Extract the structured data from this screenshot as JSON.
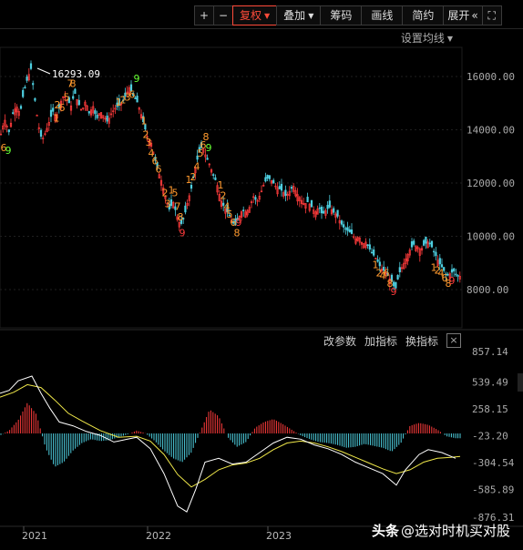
{
  "toolbar": {
    "plus_label": "+",
    "minus_label": "−",
    "fuquan_label": "复权",
    "diejia_label": "叠加",
    "chouma_label": "筹码",
    "huaxian_label": "画线",
    "jianyue_label": "简约",
    "zhankai_label": "展开",
    "collapse_icon": "«",
    "fullscreen_icon": "⛶",
    "active_color": "#ff4b3a"
  },
  "main_panel": {
    "ma_setting_label": "设置均线",
    "peak_label": "16293.09",
    "y_ticks": [
      "16000.00",
      "14000.00",
      "12000.00",
      "10000.00",
      "8000.00"
    ]
  },
  "indicator_panel": {
    "change_params_label": "改参数",
    "add_indicator_label": "加指标",
    "switch_indicator_label": "换指标",
    "close_icon": "×",
    "y_ticks": [
      "857.14",
      "539.49",
      "258.15",
      "-23.20",
      "-304.54",
      "-585.89",
      "-876.31"
    ]
  },
  "x_axis": {
    "years": [
      "2021",
      "2022",
      "2023"
    ]
  },
  "watermark": {
    "text": "@选对时机买对股",
    "prefix": "头条"
  },
  "chart_data": {
    "type": "candlestick-macd",
    "peak": 16293.09,
    "y_range": [
      7600,
      16600
    ],
    "macd_range": [
      -876.31,
      857.14
    ],
    "colors": {
      "up": "#ff3b3b",
      "down": "#4ecfe0",
      "seq_orange": "#ff9a2e",
      "seq_green": "#66ff33",
      "seq_red": "#ff3b3b",
      "dif": "#ffffff",
      "dea": "#f0e84a"
    },
    "close_path": [
      [
        0,
        13700
      ],
      [
        5,
        14400
      ],
      [
        10,
        13900
      ],
      [
        14,
        14600
      ],
      [
        18,
        14900
      ],
      [
        22,
        14600
      ],
      [
        26,
        15400
      ],
      [
        30,
        15900
      ],
      [
        34,
        16293
      ],
      [
        38,
        15200
      ],
      [
        42,
        14200
      ],
      [
        46,
        13600
      ],
      [
        50,
        13900
      ],
      [
        54,
        14300
      ],
      [
        58,
        14700
      ],
      [
        62,
        14500
      ],
      [
        66,
        15000
      ],
      [
        70,
        15300
      ],
      [
        74,
        15100
      ],
      [
        78,
        14900
      ],
      [
        82,
        15400
      ],
      [
        86,
        15000
      ],
      [
        90,
        14700
      ],
      [
        94,
        15100
      ],
      [
        98,
        14600
      ],
      [
        102,
        14900
      ],
      [
        106,
        14400
      ],
      [
        110,
        14700
      ],
      [
        114,
        14500
      ],
      [
        118,
        14300
      ],
      [
        122,
        14600
      ],
      [
        126,
        14800
      ],
      [
        130,
        14900
      ],
      [
        134,
        15000
      ],
      [
        138,
        15300
      ],
      [
        142,
        15600
      ],
      [
        146,
        15300
      ],
      [
        150,
        15100
      ],
      [
        154,
        14700
      ],
      [
        158,
        14200
      ],
      [
        162,
        13700
      ],
      [
        166,
        13500
      ],
      [
        170,
        12900
      ],
      [
        174,
        12400
      ],
      [
        178,
        12000
      ],
      [
        182,
        11400
      ],
      [
        186,
        11000
      ],
      [
        190,
        11300
      ],
      [
        194,
        10800
      ],
      [
        198,
        10400
      ],
      [
        202,
        10700
      ],
      [
        206,
        11300
      ],
      [
        210,
        11800
      ],
      [
        214,
        12500
      ],
      [
        218,
        13100
      ],
      [
        222,
        13400
      ],
      [
        226,
        13000
      ],
      [
        230,
        12700
      ],
      [
        234,
        12300
      ],
      [
        238,
        12000
      ],
      [
        242,
        11400
      ],
      [
        246,
        11100
      ],
      [
        250,
        10900
      ],
      [
        254,
        10600
      ],
      [
        258,
        10400
      ],
      [
        262,
        10700
      ],
      [
        266,
        11000
      ],
      [
        270,
        10900
      ],
      [
        274,
        11100
      ],
      [
        278,
        11500
      ],
      [
        282,
        11300
      ],
      [
        286,
        11600
      ],
      [
        290,
        12000
      ],
      [
        294,
        12200
      ],
      [
        298,
        12100
      ],
      [
        302,
        11900
      ],
      [
        306,
        11800
      ],
      [
        310,
        11700
      ],
      [
        314,
        11500
      ],
      [
        318,
        11700
      ],
      [
        322,
        11900
      ],
      [
        326,
        11600
      ],
      [
        330,
        11400
      ],
      [
        334,
        11200
      ],
      [
        338,
        11300
      ],
      [
        342,
        11100
      ],
      [
        346,
        10900
      ],
      [
        350,
        11100
      ],
      [
        354,
        10800
      ],
      [
        358,
        11000
      ],
      [
        362,
        11100
      ],
      [
        366,
        10900
      ],
      [
        370,
        10800
      ],
      [
        374,
        10500
      ],
      [
        378,
        10300
      ],
      [
        382,
        10200
      ],
      [
        386,
        10100
      ],
      [
        390,
        9900
      ],
      [
        394,
        10000
      ],
      [
        398,
        9700
      ],
      [
        402,
        9800
      ],
      [
        406,
        9500
      ],
      [
        410,
        9300
      ],
      [
        414,
        9100
      ],
      [
        418,
        8800
      ],
      [
        422,
        8700
      ],
      [
        426,
        8500
      ],
      [
        430,
        8300
      ],
      [
        434,
        8000
      ],
      [
        438,
        8600
      ],
      [
        442,
        8900
      ],
      [
        446,
        9200
      ],
      [
        450,
        9500
      ],
      [
        454,
        9700
      ],
      [
        458,
        9600
      ],
      [
        462,
        9500
      ],
      [
        466,
        9700
      ],
      [
        470,
        9800
      ],
      [
        474,
        9600
      ],
      [
        478,
        9300
      ],
      [
        482,
        9000
      ],
      [
        486,
        8800
      ],
      [
        490,
        8500
      ],
      [
        494,
        8600
      ],
      [
        498,
        8700
      ],
      [
        502,
        8500
      ]
    ],
    "macd_path": [
      [
        0,
        -20
      ],
      [
        10,
        30
      ],
      [
        20,
        140
      ],
      [
        30,
        320
      ],
      [
        40,
        200
      ],
      [
        50,
        -150
      ],
      [
        60,
        -350
      ],
      [
        70,
        -300
      ],
      [
        80,
        -180
      ],
      [
        90,
        -100
      ],
      [
        100,
        -60
      ],
      [
        110,
        -80
      ],
      [
        120,
        -70
      ],
      [
        130,
        -40
      ],
      [
        140,
        -10
      ],
      [
        150,
        30
      ],
      [
        160,
        0
      ],
      [
        170,
        -80
      ],
      [
        180,
        -180
      ],
      [
        190,
        -260
      ],
      [
        200,
        -300
      ],
      [
        210,
        -200
      ],
      [
        220,
        20
      ],
      [
        230,
        250
      ],
      [
        240,
        180
      ],
      [
        250,
        -40
      ],
      [
        260,
        -140
      ],
      [
        270,
        -90
      ],
      [
        280,
        60
      ],
      [
        290,
        120
      ],
      [
        300,
        150
      ],
      [
        310,
        100
      ],
      [
        320,
        40
      ],
      [
        330,
        -20
      ],
      [
        340,
        -60
      ],
      [
        350,
        -90
      ],
      [
        360,
        -100
      ],
      [
        370,
        -120
      ],
      [
        380,
        -150
      ],
      [
        390,
        -140
      ],
      [
        400,
        -110
      ],
      [
        410,
        -130
      ],
      [
        420,
        -150
      ],
      [
        430,
        -190
      ],
      [
        440,
        -100
      ],
      [
        450,
        80
      ],
      [
        460,
        110
      ],
      [
        470,
        90
      ],
      [
        480,
        40
      ],
      [
        490,
        -30
      ],
      [
        500,
        -50
      ]
    ],
    "dif_path": [
      [
        0,
        420
      ],
      [
        10,
        450
      ],
      [
        20,
        550
      ],
      [
        35,
        600
      ],
      [
        45,
        420
      ],
      [
        55,
        260
      ],
      [
        65,
        120
      ],
      [
        80,
        80
      ],
      [
        95,
        20
      ],
      [
        110,
        -20
      ],
      [
        125,
        -90
      ],
      [
        140,
        -60
      ],
      [
        150,
        -40
      ],
      [
        165,
        -160
      ],
      [
        180,
        -420
      ],
      [
        195,
        -760
      ],
      [
        205,
        -820
      ],
      [
        215,
        -580
      ],
      [
        225,
        -300
      ],
      [
        240,
        -260
      ],
      [
        255,
        -320
      ],
      [
        270,
        -300
      ],
      [
        285,
        -200
      ],
      [
        300,
        -100
      ],
      [
        315,
        -40
      ],
      [
        330,
        -60
      ],
      [
        345,
        -120
      ],
      [
        360,
        -160
      ],
      [
        375,
        -220
      ],
      [
        390,
        -300
      ],
      [
        405,
        -360
      ],
      [
        420,
        -420
      ],
      [
        435,
        -540
      ],
      [
        445,
        -380
      ],
      [
        460,
        -220
      ],
      [
        470,
        -170
      ],
      [
        485,
        -200
      ],
      [
        500,
        -260
      ]
    ],
    "dea_path": [
      [
        0,
        380
      ],
      [
        15,
        430
      ],
      [
        30,
        510
      ],
      [
        45,
        480
      ],
      [
        60,
        350
      ],
      [
        75,
        210
      ],
      [
        90,
        130
      ],
      [
        110,
        30
      ],
      [
        130,
        -40
      ],
      [
        150,
        -30
      ],
      [
        165,
        -80
      ],
      [
        180,
        -220
      ],
      [
        195,
        -430
      ],
      [
        210,
        -560
      ],
      [
        225,
        -480
      ],
      [
        240,
        -380
      ],
      [
        255,
        -330
      ],
      [
        270,
        -310
      ],
      [
        285,
        -260
      ],
      [
        300,
        -170
      ],
      [
        315,
        -100
      ],
      [
        330,
        -80
      ],
      [
        345,
        -100
      ],
      [
        360,
        -140
      ],
      [
        375,
        -190
      ],
      [
        390,
        -250
      ],
      [
        405,
        -310
      ],
      [
        420,
        -370
      ],
      [
        435,
        -420
      ],
      [
        450,
        -380
      ],
      [
        465,
        -300
      ],
      [
        480,
        -260
      ],
      [
        495,
        -250
      ],
      [
        505,
        -240
      ]
    ],
    "seq_labels": [
      {
        "x": 4,
        "v": 13200,
        "t": "6",
        "c": "o"
      },
      {
        "x": 9,
        "v": 13100,
        "t": "9",
        "c": "g"
      },
      {
        "x": 63,
        "v": 14800,
        "t": "2",
        "c": "o"
      },
      {
        "x": 68,
        "v": 14700,
        "t": "6",
        "c": "o"
      },
      {
        "x": 73,
        "v": 15100,
        "t": "5",
        "c": "o"
      },
      {
        "x": 77,
        "v": 15600,
        "t": "7",
        "c": "o"
      },
      {
        "x": 80,
        "v": 15600,
        "t": "8",
        "c": "o"
      },
      {
        "x": 62,
        "v": 14300,
        "t": "1",
        "c": "o"
      },
      {
        "x": 130,
        "v": 14900,
        "t": "1",
        "c": "o"
      },
      {
        "x": 135,
        "v": 15000,
        "t": "2",
        "c": "o"
      },
      {
        "x": 140,
        "v": 15100,
        "t": "3",
        "c": "o"
      },
      {
        "x": 145,
        "v": 15200,
        "t": "6",
        "c": "o"
      },
      {
        "x": 150,
        "v": 15800,
        "t": "9",
        "c": "g"
      },
      {
        "x": 158,
        "v": 14200,
        "t": "1",
        "c": "o"
      },
      {
        "x": 160,
        "v": 13700,
        "t": "2",
        "c": "o"
      },
      {
        "x": 163,
        "v": 13400,
        "t": "3",
        "c": "o"
      },
      {
        "x": 166,
        "v": 13000,
        "t": "4",
        "c": "o"
      },
      {
        "x": 170,
        "v": 12700,
        "t": "6",
        "c": "o"
      },
      {
        "x": 174,
        "v": 12400,
        "t": "6",
        "c": "o"
      },
      {
        "x": 181,
        "v": 11500,
        "t": "2",
        "c": "o"
      },
      {
        "x": 184,
        "v": 11100,
        "t": "3",
        "c": "o"
      },
      {
        "x": 188,
        "v": 11600,
        "t": "1",
        "c": "o"
      },
      {
        "x": 192,
        "v": 11500,
        "t": "5",
        "c": "o"
      },
      {
        "x": 195,
        "v": 11000,
        "t": "7",
        "c": "o"
      },
      {
        "x": 198,
        "v": 10600,
        "t": "8",
        "c": "o"
      },
      {
        "x": 200,
        "v": 10000,
        "t": "9",
        "c": "r"
      },
      {
        "x": 207,
        "v": 12000,
        "t": "1",
        "c": "o"
      },
      {
        "x": 212,
        "v": 12100,
        "t": "2",
        "c": "o"
      },
      {
        "x": 216,
        "v": 12500,
        "t": "4",
        "c": "o"
      },
      {
        "x": 220,
        "v": 13000,
        "t": "5",
        "c": "o"
      },
      {
        "x": 223,
        "v": 13300,
        "t": "6",
        "c": "o"
      },
      {
        "x": 226,
        "v": 13600,
        "t": "8",
        "c": "o"
      },
      {
        "x": 229,
        "v": 13200,
        "t": "9",
        "c": "g"
      },
      {
        "x": 242,
        "v": 11800,
        "t": "1",
        "c": "o"
      },
      {
        "x": 245,
        "v": 11400,
        "t": "2",
        "c": "o"
      },
      {
        "x": 249,
        "v": 11000,
        "t": "4",
        "c": "o"
      },
      {
        "x": 252,
        "v": 10700,
        "t": "5",
        "c": "o"
      },
      {
        "x": 256,
        "v": 10400,
        "t": "6",
        "c": "o"
      },
      {
        "x": 262,
        "v": 10400,
        "t": "9",
        "c": "r"
      },
      {
        "x": 260,
        "v": 10000,
        "t": "8",
        "c": "o"
      },
      {
        "x": 412,
        "v": 8800,
        "t": "1",
        "c": "o"
      },
      {
        "x": 416,
        "v": 8500,
        "t": "2",
        "c": "o"
      },
      {
        "x": 420,
        "v": 8400,
        "t": "4",
        "c": "o"
      },
      {
        "x": 424,
        "v": 8500,
        "t": "6",
        "c": "o"
      },
      {
        "x": 428,
        "v": 8100,
        "t": "8",
        "c": "o"
      },
      {
        "x": 432,
        "v": 7800,
        "t": "9",
        "c": "r"
      },
      {
        "x": 476,
        "v": 8700,
        "t": "1",
        "c": "o"
      },
      {
        "x": 480,
        "v": 8600,
        "t": "2",
        "c": "o"
      },
      {
        "x": 484,
        "v": 8500,
        "t": "4",
        "c": "o"
      },
      {
        "x": 488,
        "v": 8300,
        "t": "6",
        "c": "o"
      },
      {
        "x": 492,
        "v": 8100,
        "t": "8",
        "c": "o"
      },
      {
        "x": 496,
        "v": 8200,
        "t": "9",
        "c": "r"
      }
    ]
  }
}
